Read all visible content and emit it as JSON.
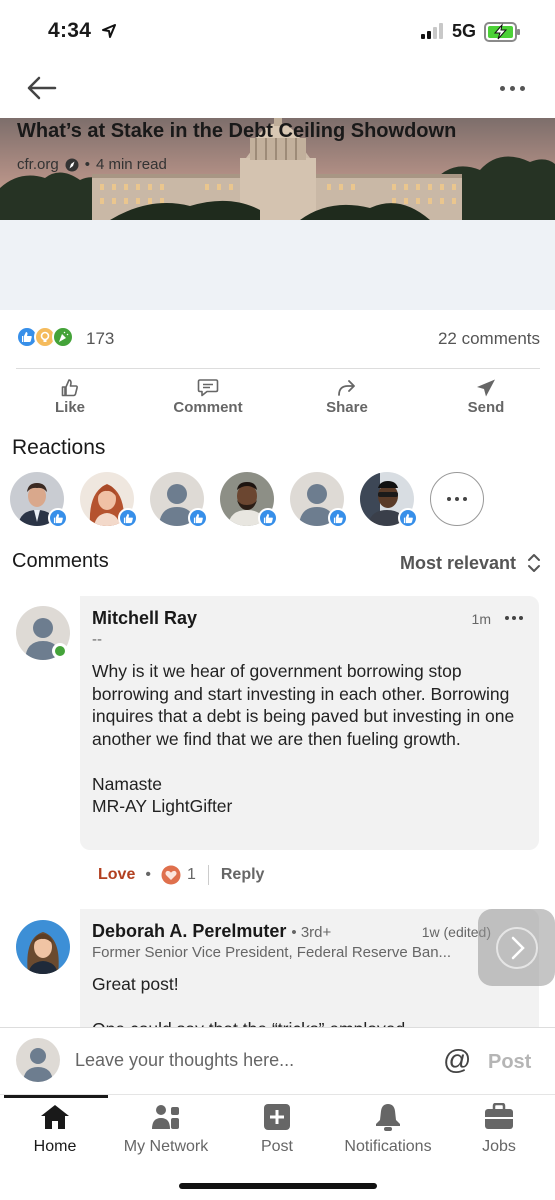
{
  "status_bar": {
    "time": "4:34",
    "network": "5G"
  },
  "article": {
    "title": "What’s at Stake in the Debt Ceiling Showdown",
    "source": "cfr.org",
    "separator": "•",
    "read_time": "4 min read"
  },
  "social": {
    "reaction_icons": [
      "like-icon",
      "insightful-icon",
      "celebrate-icon"
    ],
    "reaction_count": "173",
    "comments_count": "22 comments"
  },
  "actions": {
    "like": "Like",
    "comment": "Comment",
    "share": "Share",
    "send": "Send"
  },
  "reactions": {
    "title": "Reactions",
    "people": [
      {
        "avatar": "person-photo"
      },
      {
        "avatar": "person-photo"
      },
      {
        "avatar": "default-avatar"
      },
      {
        "avatar": "person-photo"
      },
      {
        "avatar": "default-avatar"
      },
      {
        "avatar": "person-photo"
      }
    ]
  },
  "comments": {
    "title": "Comments",
    "sort_label": "Most relevant",
    "items": [
      {
        "name": "Mitchell Ray",
        "headline": "--",
        "time": "1m",
        "body": "Why is it we hear of government borrowing stop borrowing and start investing in each other. Borrowing inquires that a debt is being paved but investing in one another we find that we are then fueling growth.\n\nNamaste\nMR-AY LightGifter",
        "reaction_label": "Love",
        "reaction_count": "1",
        "reply_label": "Reply"
      },
      {
        "name": "Deborah A. Perelmuter",
        "degree": "• 3rd+",
        "headline": "Former Senior Vice President, Federal Reserve Ban...",
        "time": "1w (edited)",
        "body": "Great post!\n\nOne could say that the “tricks” employed"
      }
    ]
  },
  "compose": {
    "placeholder": "Leave your thoughts here...",
    "at_symbol": "@",
    "post_label": "Post"
  },
  "tabs": [
    {
      "label": "Home",
      "icon": "home-icon",
      "active": true
    },
    {
      "label": "My Network",
      "icon": "network-icon"
    },
    {
      "label": "Post",
      "icon": "plus-square-icon"
    },
    {
      "label": "Notifications",
      "icon": "bell-icon"
    },
    {
      "label": "Jobs",
      "icon": "briefcase-icon"
    }
  ],
  "colors": {
    "like_blue": "#378fe9",
    "love_red": "#b24020",
    "online_green": "#44a339",
    "meta_bg": "#eef2f6"
  }
}
